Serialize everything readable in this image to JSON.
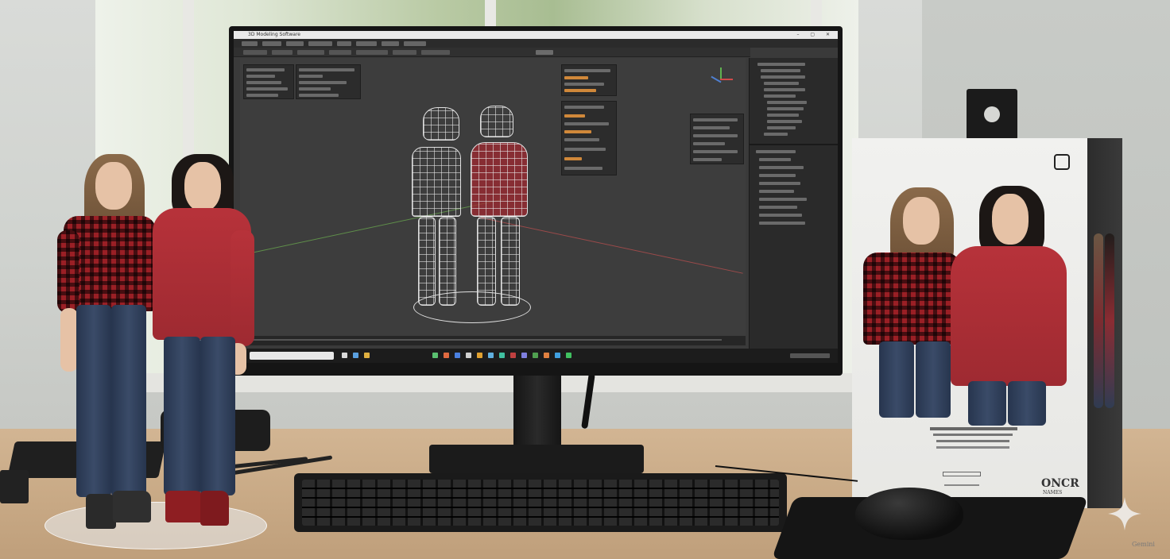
{
  "scene": {
    "description_free": true
  },
  "editor": {
    "title": "3D Modeling Software"
  },
  "box": {
    "brand": "ONCR",
    "brand_sub": "NAMES"
  },
  "watermark": {
    "label": "Gemini"
  },
  "colors": {
    "hoodie": "#b0303a",
    "plaid": "#9a1f25",
    "jeans": "#2f3e5a",
    "screen": "#3a3a3a",
    "desk": "#c9aa86"
  }
}
